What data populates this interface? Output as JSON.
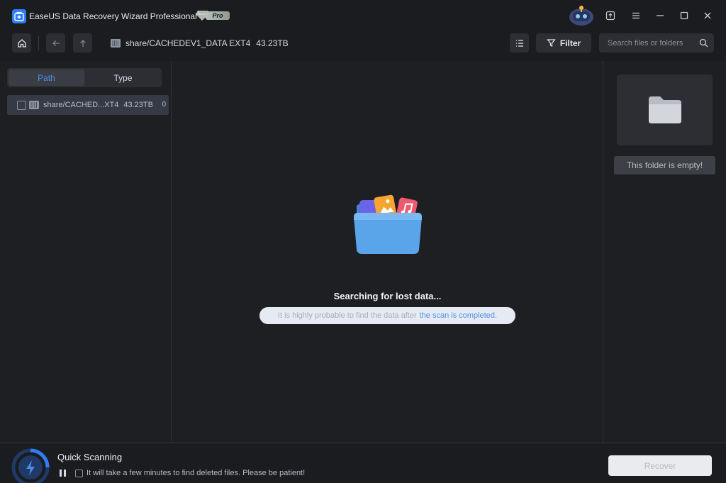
{
  "window": {
    "title": "EaseUS Data Recovery Wizard Professional",
    "badge": "Pro",
    "controls": [
      "upload-icon",
      "menu-icon",
      "minimize-icon",
      "maximize-icon",
      "close-icon"
    ]
  },
  "toolbar": {
    "drive_name": "share/CACHEDEV1_DATA EXT4",
    "drive_size": "43.23TB",
    "filter_label": "Filter",
    "search_placeholder": "Search files or folders"
  },
  "left_panel": {
    "tabs": [
      {
        "label": "Path",
        "active": true
      },
      {
        "label": "Type",
        "active": false
      }
    ],
    "tree": [
      {
        "label": "share/CACHED...XT4",
        "size": "43.23TB",
        "count": "0",
        "checked": false
      }
    ]
  },
  "center": {
    "status": "Searching for lost data...",
    "hint_prefix": "It is highly probable to find the data after",
    "hint_link": "the scan is completed."
  },
  "right_panel": {
    "empty_text": "This folder is empty!"
  },
  "bottom": {
    "scan_title": "Quick Scanning",
    "scan_message": "It will take a few minutes to find deleted files. Please be patient!",
    "recover_label": "Recover"
  },
  "colors": {
    "accent": "#2f7ef5",
    "background": "#1e1f23",
    "link": "#4d8fe8"
  }
}
